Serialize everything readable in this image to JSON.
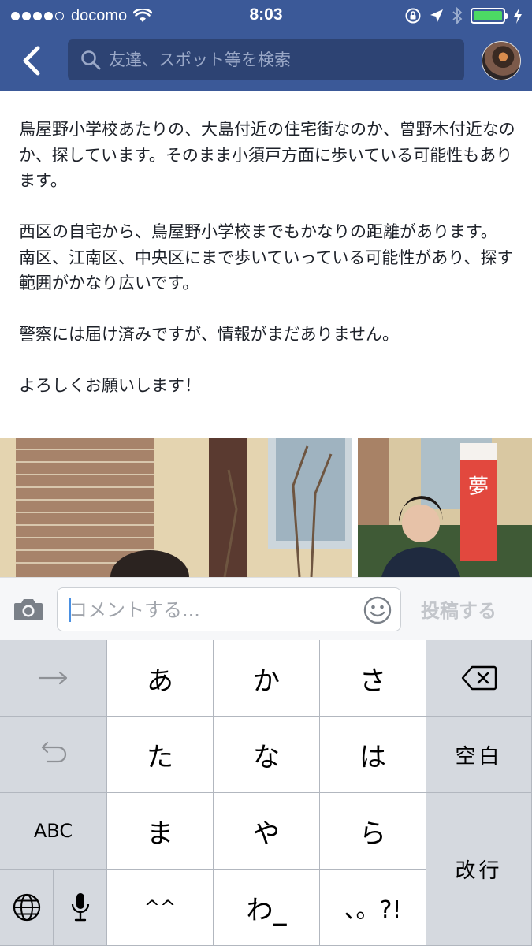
{
  "status_bar": {
    "carrier": "docomo",
    "time": "8:03",
    "signal_bars": 4,
    "battery_level": 1.0
  },
  "nav": {
    "back_icon": "chevron-left-icon",
    "search_placeholder": "友達、スポット等を検索"
  },
  "post": {
    "paragraphs": [
      "鳥屋野小学校あたりの、大島付近の住宅街なのか、曽野木付近なのか、探しています。そのまま小須戸方面に歩いている可能性もあります。",
      "西区の自宅から、鳥屋野小学校までもかなりの距離があります。",
      "南区、江南区、中央区にまで歩いていっている可能性があり、探す範囲がかなり広いです。",
      "警察には届け済みですが、情報がまだありません。",
      "よろしくお願いします！"
    ]
  },
  "comment": {
    "placeholder": "コメントする...",
    "post_label": "投稿する"
  },
  "keyboard": {
    "row1": [
      "あ",
      "か",
      "さ"
    ],
    "row2": [
      "た",
      "な",
      "は"
    ],
    "row3": [
      "ま",
      "や",
      "ら"
    ],
    "row4": [
      "^^",
      "わ_",
      "、。?!"
    ],
    "abc_label": "ABC",
    "space_label": "空白",
    "return_label": "改行"
  },
  "colors": {
    "fb_blue": "#3b5998",
    "search_bg": "#2d4373",
    "battery_green": "#4cd964",
    "keyboard_bg": "#cfd3d9"
  }
}
